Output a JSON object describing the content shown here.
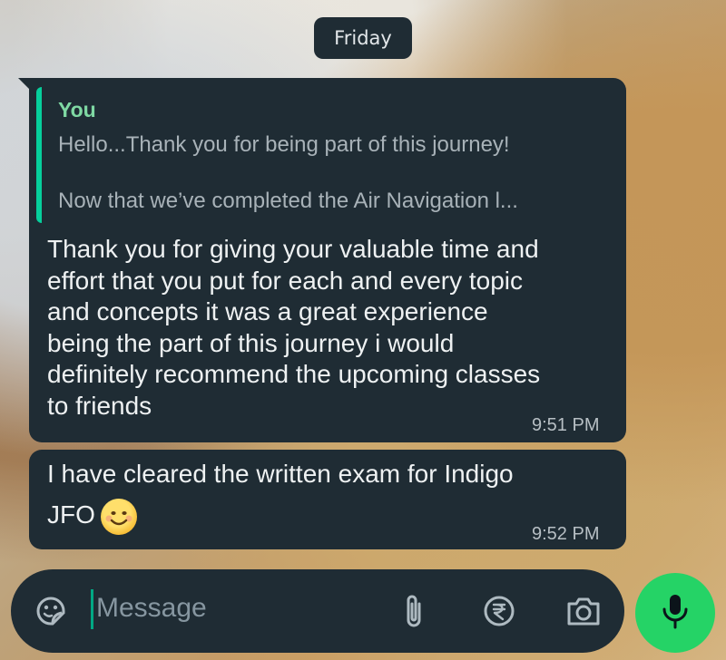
{
  "date_chip": "Friday",
  "messages": [
    {
      "quote": {
        "author": "You",
        "line1": "Hello...Thank you for being part of this journey!",
        "line2": "Now that we’ve completed the Air Navigation l..."
      },
      "text_lines": [
        "Thank you for giving your valuable time and",
        "effort that you put for each and every topic",
        "and concepts it was a great experience",
        "being the part of this journey i would",
        "definitely recommend the upcoming classes",
        "to friends"
      ],
      "time": "9:51 PM"
    },
    {
      "text_line1": "I have cleared the written exam for Indigo",
      "text_line2": "JFO",
      "emoji": "smiling-face-emoji",
      "time": "9:52 PM"
    }
  ],
  "composer": {
    "placeholder": "Message",
    "icons": [
      "sticker-icon",
      "attach-icon",
      "rupee-payment-icon",
      "camera-icon",
      "mic-icon"
    ]
  },
  "colors": {
    "bubble": "#1f2c34",
    "accent": "#06cf9c",
    "mic_button": "#25d366",
    "placeholder": "#8696a0"
  }
}
